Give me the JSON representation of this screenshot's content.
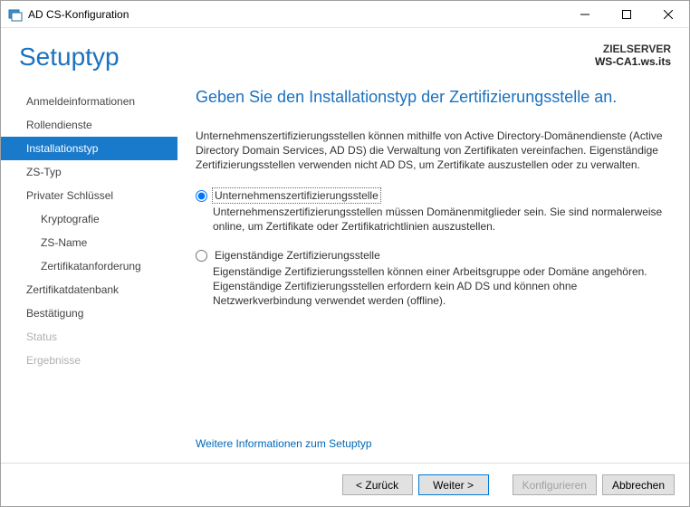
{
  "window": {
    "title": "AD CS-Konfiguration"
  },
  "header": {
    "heading": "Setuptyp",
    "target_label": "ZIELSERVER",
    "target_server": "WS-CA1.ws.its"
  },
  "sidebar": {
    "items": [
      {
        "label": "Anmeldeinformationen",
        "selected": false,
        "indent": false
      },
      {
        "label": "Rollendienste",
        "selected": false,
        "indent": false
      },
      {
        "label": "Installationstyp",
        "selected": true,
        "indent": false
      },
      {
        "label": "ZS-Typ",
        "selected": false,
        "indent": false
      },
      {
        "label": "Privater Schlüssel",
        "selected": false,
        "indent": false
      },
      {
        "label": "Kryptografie",
        "selected": false,
        "indent": true
      },
      {
        "label": "ZS-Name",
        "selected": false,
        "indent": true
      },
      {
        "label": "Zertifikatanforderung",
        "selected": false,
        "indent": true
      },
      {
        "label": "Zertifikatdatenbank",
        "selected": false,
        "indent": false
      },
      {
        "label": "Bestätigung",
        "selected": false,
        "indent": false
      },
      {
        "label": "Status",
        "selected": false,
        "indent": false,
        "disabled": true
      },
      {
        "label": "Ergebnisse",
        "selected": false,
        "indent": false,
        "disabled": true
      }
    ]
  },
  "content": {
    "title": "Geben Sie den Installationstyp der Zertifizierungsstelle an.",
    "intro": "Unternehmenszertifizierungsstellen können mithilfe von Active Directory-Domänendienste (Active Directory Domain Services, AD DS) die Verwaltung von Zertifikaten vereinfachen. Eigenständige Zertifizierungsstellen verwenden nicht AD DS, um Zertifikate auszustellen oder zu verwalten.",
    "options": [
      {
        "title": "Unternehmenszertifizierungsstelle",
        "desc": "Unternehmenszertifizierungsstellen müssen Domänenmitglieder sein. Sie sind normalerweise online, um Zertifikate oder Zertifikatrichtlinien auszustellen.",
        "checked": true
      },
      {
        "title": "Eigenständige Zertifizierungsstelle",
        "desc": "Eigenständige Zertifizierungsstellen können einer Arbeitsgruppe oder Domäne angehören. Eigenständige Zertifizierungsstellen erfordern kein AD DS und können ohne Netzwerkverbindung verwendet werden (offline).",
        "checked": false
      }
    ],
    "more_link": "Weitere Informationen zum Setuptyp"
  },
  "footer": {
    "back": "< Zurück",
    "next": "Weiter >",
    "configure": "Konfigurieren",
    "cancel": "Abbrechen"
  }
}
